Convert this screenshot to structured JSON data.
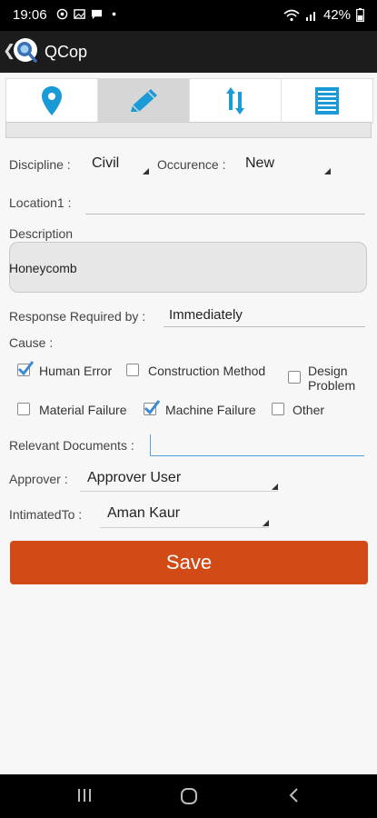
{
  "status_bar": {
    "time": "19:06",
    "battery": "42%",
    "icons": [
      "whatsapp-icon",
      "gallery-icon",
      "message-icon",
      "dot-icon",
      "wifi-icon",
      "signal-icon",
      "battery-icon"
    ]
  },
  "app_bar": {
    "title": "QCop",
    "icons": [
      "back-icon",
      "app-logo"
    ]
  },
  "tabs": [
    {
      "icon": "location-pin-icon",
      "active": false
    },
    {
      "icon": "pencil-icon",
      "active": true
    },
    {
      "icon": "sort-arrows-icon",
      "active": false
    },
    {
      "icon": "list-icon",
      "active": false
    }
  ],
  "form": {
    "discipline_label": "Discipline :",
    "discipline_value": "Civil",
    "occurence_label": "Occurence :",
    "occurence_value": "New",
    "location_label": "Location1 :",
    "location_value": "",
    "description_label": "Description",
    "description_value": "Honeycomb",
    "response_label": "Response Required by :",
    "response_value": "Immediately",
    "cause_label": "Cause :",
    "causes": [
      {
        "label": "Human Error",
        "checked": true
      },
      {
        "label": "Construction Method",
        "checked": false
      },
      {
        "label": "Design Problem",
        "checked": false
      },
      {
        "label": "Material Failure",
        "checked": false
      },
      {
        "label": "Machine Failure",
        "checked": true
      },
      {
        "label": "Other",
        "checked": false
      }
    ],
    "relevant_docs_label": "Relevant Documents :",
    "relevant_docs_value": "",
    "approver_label": "Approver :",
    "approver_value": "Approver User",
    "intimated_label": "IntimatedTo :",
    "intimated_value": "Aman Kaur",
    "save_label": "Save"
  },
  "colors": {
    "accent_blue": "#1a9ad6",
    "save_orange": "#d24b17",
    "check_blue": "#3a8ad4"
  },
  "nav_bar": {
    "icons": [
      "recent-apps-icon",
      "home-icon",
      "back-nav-icon"
    ]
  }
}
